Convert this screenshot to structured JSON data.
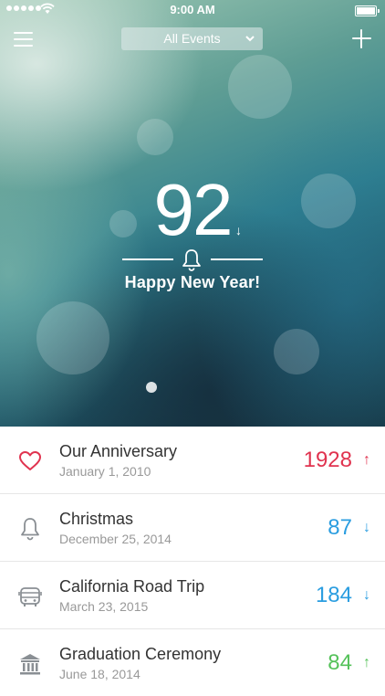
{
  "status_bar": {
    "time": "9:00 AM"
  },
  "header": {
    "filter_label": "All Events",
    "filter_icon": "chevron-down-icon"
  },
  "featured": {
    "count": "92",
    "count_direction_icon": "arrow-down-icon",
    "icon": "bell-icon",
    "title": "Happy New Year!"
  },
  "events": [
    {
      "name": "Our Anniversary",
      "date": "January 1, 2010",
      "count": "1928",
      "direction": "↑",
      "icon": "heart-icon",
      "color": "#e0334f"
    },
    {
      "name": "Christmas",
      "date": "December 25, 2014",
      "count": "87",
      "direction": "↓",
      "icon": "bell-icon",
      "color": "#2a9de0"
    },
    {
      "name": "California Road Trip",
      "date": "March 23, 2015",
      "count": "184",
      "direction": "↓",
      "icon": "bus-icon",
      "color": "#2a9de0"
    },
    {
      "name": "Graduation Ceremony",
      "date": "June 18, 2014",
      "count": "84",
      "direction": "↑",
      "icon": "museum-icon",
      "color": "#55c25a"
    }
  ],
  "colors": {
    "up_red": "#e0334f",
    "down_blue": "#2a9de0",
    "up_green": "#55c25a",
    "icon_gray": "#8a8f94"
  }
}
